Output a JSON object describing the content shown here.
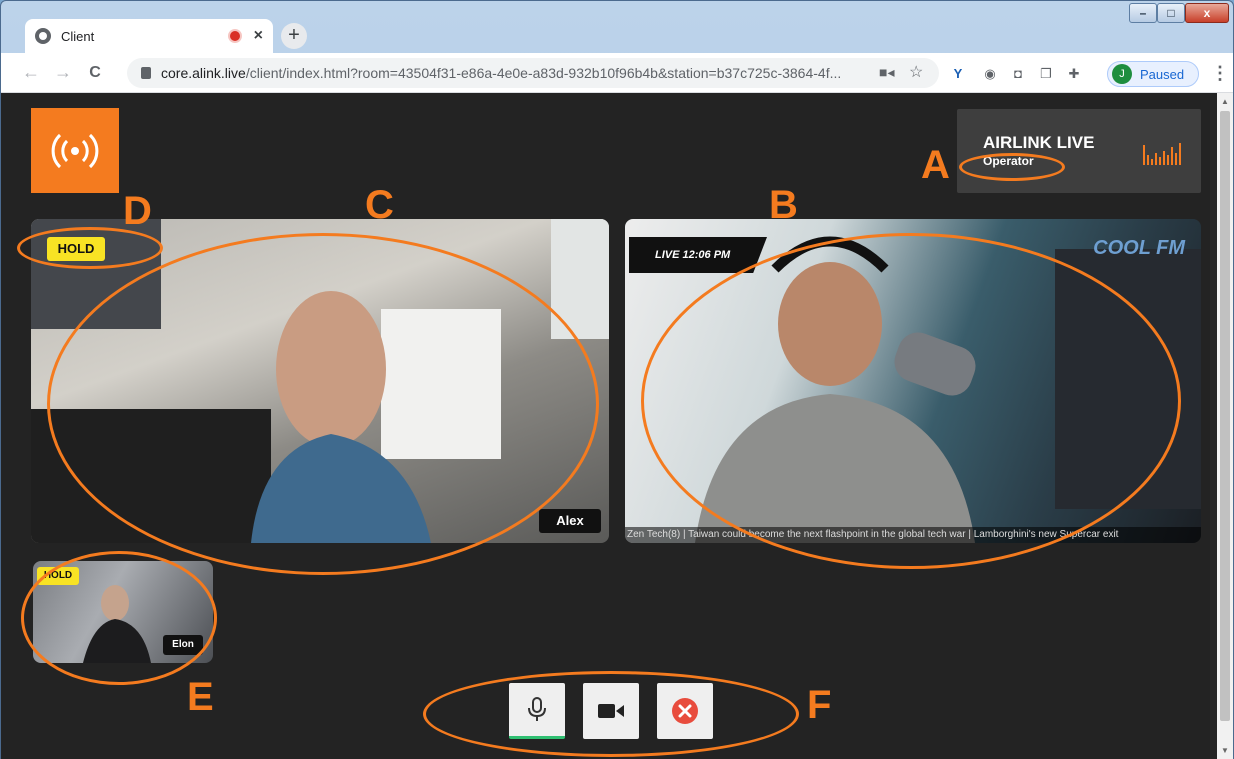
{
  "browser": {
    "tab_title": "Client",
    "tab_close": "×",
    "new_tab": "+",
    "window_controls": {
      "minimize": "–",
      "maximize": "□",
      "close": "x"
    },
    "nav": {
      "back": "←",
      "forward": "→",
      "reload": "C"
    },
    "url_host": "core.alink.live",
    "url_rest": "/client/index.html?room=43504f31-e86a-4e0e-a83d-932b10f96b4b&station=b37c725c-3864-4f...",
    "profile_initial": "J",
    "profile_status": "Paused",
    "menu": "⋮"
  },
  "app": {
    "logo_icon": "broadcast-icon",
    "station_name": "AIRLINK LIVE",
    "station_role": "Operator",
    "tiles": {
      "alex": {
        "hold": "HOLD",
        "name": "Alex"
      },
      "host": {
        "live": "LIVE 12:06 PM",
        "brand": "COOL FM",
        "ticker": "Zen Tech(8) | Taiwan could become the next flashpoint in the global tech war | Lamborghini's new Supercar exit"
      },
      "elon": {
        "hold": "HOLD",
        "name": "Elon"
      }
    },
    "controls": {
      "mic_icon": "microphone-icon",
      "camera_icon": "video-camera-icon",
      "hangup_icon": "close-circle-icon"
    }
  },
  "annotations": {
    "A": "A",
    "B": "B",
    "C": "C",
    "D": "D",
    "E": "E",
    "F": "F",
    "color": "#f47b1f"
  },
  "colors": {
    "accent": "#f47b1f",
    "hold": "#f8e324",
    "page_bg": "#232323"
  }
}
